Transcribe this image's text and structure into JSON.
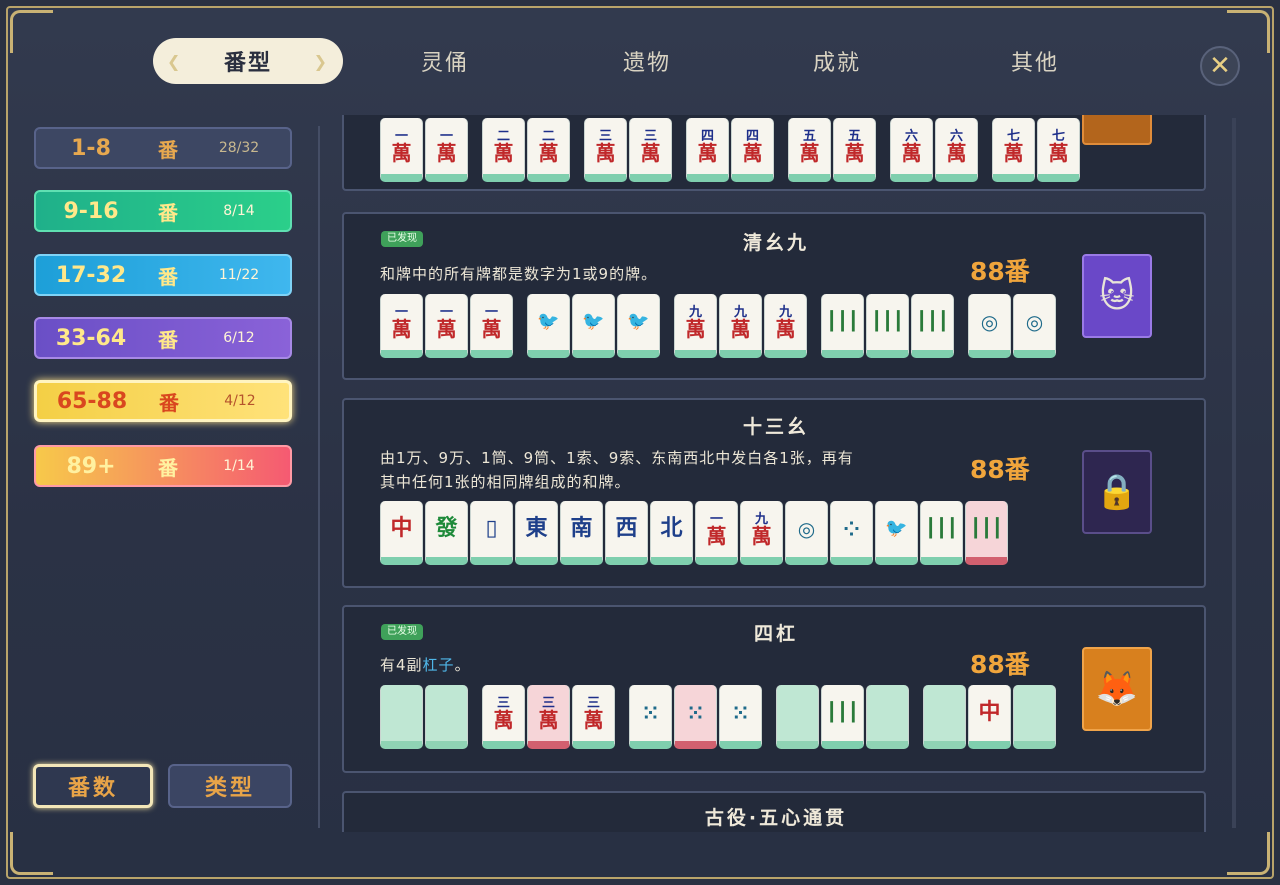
{
  "tabs": [
    "番型",
    "灵俑",
    "遗物",
    "成就",
    "其他"
  ],
  "close_icon": "✕",
  "categories": [
    {
      "range": "1-8",
      "fan": "番",
      "count": "28/32"
    },
    {
      "range": "9-16",
      "fan": "番",
      "count": "8/14"
    },
    {
      "range": "17-32",
      "fan": "番",
      "count": "11/22"
    },
    {
      "range": "33-64",
      "fan": "番",
      "count": "6/12"
    },
    {
      "range": "65-88",
      "fan": "番",
      "count": "4/12"
    },
    {
      "range": "89+",
      "fan": "番",
      "count": "1/14"
    }
  ],
  "bottom_buttons": {
    "fan_count": "番数",
    "type": "类型"
  },
  "cards": [
    {
      "tiles": [
        {
          "n": "一",
          "s": "萬"
        },
        {
          "n": "一",
          "s": "萬"
        },
        {
          "n": "二",
          "s": "萬"
        },
        {
          "n": "二",
          "s": "萬"
        },
        {
          "n": "三",
          "s": "萬"
        },
        {
          "n": "三",
          "s": "萬"
        },
        {
          "n": "四",
          "s": "萬"
        },
        {
          "n": "四",
          "s": "萬"
        },
        {
          "n": "五",
          "s": "萬"
        },
        {
          "n": "五",
          "s": "萬"
        },
        {
          "n": "六",
          "s": "萬"
        },
        {
          "n": "六",
          "s": "萬"
        },
        {
          "n": "七",
          "s": "萬"
        },
        {
          "n": "七",
          "s": "萬"
        }
      ]
    },
    {
      "badge": "已发现",
      "title": "清幺九",
      "desc": "和牌中的所有牌都是数字为1或9的牌。",
      "fan": "88番",
      "portrait_icon": "cat-spirit-icon"
    },
    {
      "title": "十三幺",
      "desc_line1": "由1万、9万、1筒、9筒、1索、9索、东南西北中发白各1张，再有",
      "desc_line2": "其中任何1张的相同牌组成的和牌。",
      "fan": "88番",
      "portrait_icon": "locked-lock-icon",
      "honor_tiles": [
        "中",
        "發",
        "東",
        "南",
        "西",
        "北"
      ]
    },
    {
      "badge": "已发现",
      "title": "四杠",
      "desc_prefix": "有4副",
      "desc_highlight": "杠子",
      "desc_suffix": "。",
      "fan": "88番",
      "portrait_icon": "fox-mask-icon"
    },
    {
      "title": "古役·五心通贯"
    }
  ],
  "tile_labels": {
    "one": "一",
    "nine": "九",
    "wan": "萬",
    "three": "三",
    "zhong": "中"
  },
  "colors": {
    "accent": "#f0a53c",
    "badge": "#3fa15a",
    "highlight": "#4fb6e8"
  }
}
